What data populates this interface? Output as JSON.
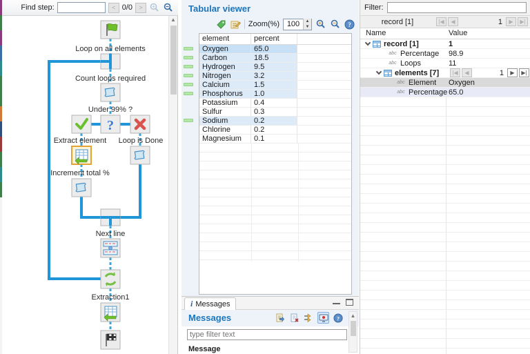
{
  "accent": {
    "title_blue": "#1b75bc",
    "flow_blue": "#2095d8",
    "select_blue": "#c7e0f6",
    "highlight_blue": "#ddeaf8",
    "marker_green": "#b5e8a8"
  },
  "palette_strip": {
    "colors": [
      "#8b3a7e",
      "#3f7d4a",
      "#8b3a7e",
      "#3a6ea5",
      "#2e8b8b",
      "#3f7d4a",
      "#3f7d4a",
      "#d2793a",
      "#2f4f7f",
      "#9b3a3a",
      "#3f7d4a",
      "#2e8b8b",
      "#3f7d4a"
    ]
  },
  "flow_toolbar": {
    "find_label": "Find step:",
    "find_value": "",
    "prev": "<",
    "counter": "0/0",
    "next": ">"
  },
  "flowchart": {
    "labels": {
      "start": "Loop on all elements",
      "count": "Count loops required",
      "decision": "Under 99% ?",
      "extract": "Extract element",
      "done": "Loop is Done",
      "increment": "Increment total %",
      "next": "Next line",
      "extraction": "Extraction1"
    }
  },
  "tabular": {
    "title": "Tabular viewer",
    "zoom_label": "Zoom(%)",
    "zoom_value": "100",
    "columns": {
      "c1": "element",
      "c2": "percent"
    },
    "rows": [
      {
        "element": "Oxygen",
        "percent": "65.0"
      },
      {
        "element": "Carbon",
        "percent": "18.5"
      },
      {
        "element": "Hydrogen",
        "percent": "9.5"
      },
      {
        "element": "Nitrogen",
        "percent": "3.2"
      },
      {
        "element": "Calcium",
        "percent": "1.5"
      },
      {
        "element": "Phosphorus",
        "percent": "1.0"
      },
      {
        "element": "Potassium",
        "percent": "0.4"
      },
      {
        "element": "Sulfur",
        "percent": "0.3"
      },
      {
        "element": "Sodium",
        "percent": "0.2"
      },
      {
        "element": "Chlorine",
        "percent": "0.2"
      },
      {
        "element": "Magnesium",
        "percent": "0.1"
      }
    ]
  },
  "messages": {
    "tab": "Messages",
    "title": "Messages",
    "filter_placeholder": "type filter text",
    "column": "Message"
  },
  "record": {
    "filter_label": "Filter:",
    "filter_value": "",
    "nav_title": "record [1]",
    "nav_page": "1",
    "columns": {
      "name": "Name",
      "value": "Value"
    },
    "rows": [
      {
        "label": "record [1]",
        "value": "1"
      },
      {
        "label": "Percentage",
        "value": "98.9"
      },
      {
        "label": "Loops",
        "value": "11"
      },
      {
        "label": "elements [7]",
        "page": "1"
      },
      {
        "label": "Element",
        "value": "Oxygen"
      },
      {
        "label": "Percentage",
        "value": "65.0"
      }
    ]
  }
}
